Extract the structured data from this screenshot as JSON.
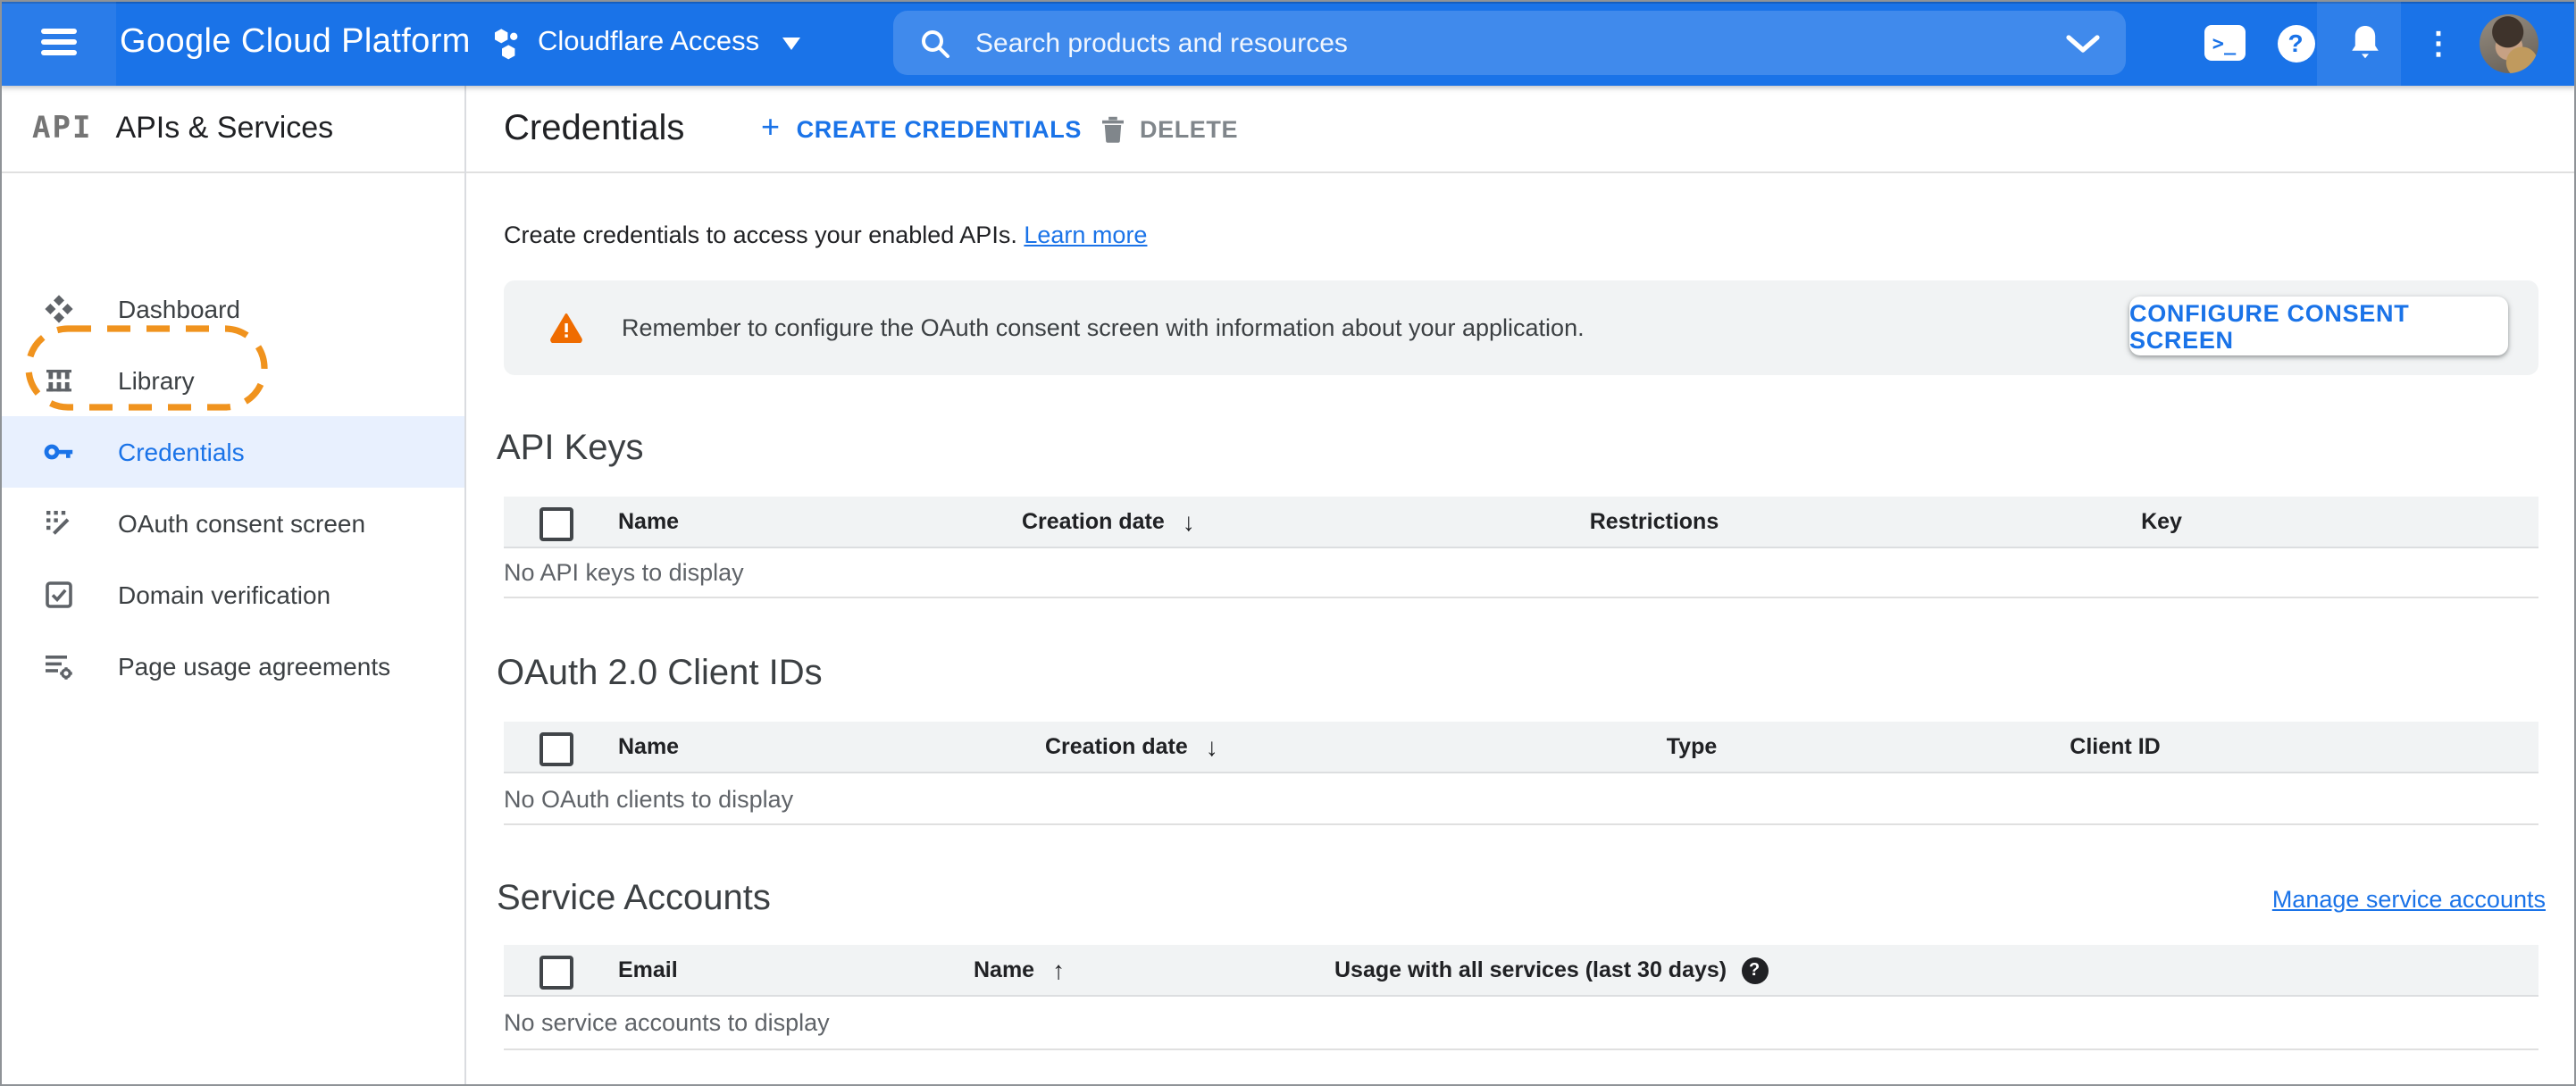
{
  "header": {
    "logo": "Google Cloud Platform",
    "project": {
      "name": "Cloudflare Access"
    },
    "search": {
      "placeholder": "Search products and resources"
    }
  },
  "sidebar": {
    "product_initials": "API",
    "title": "APIs & Services",
    "items": [
      {
        "label": "Dashboard"
      },
      {
        "label": "Library"
      },
      {
        "label": "Credentials"
      },
      {
        "label": "OAuth consent screen"
      },
      {
        "label": "Domain verification"
      },
      {
        "label": "Page usage agreements"
      }
    ],
    "active_item": "Credentials"
  },
  "toolbar": {
    "title": "Credentials",
    "create_label": "CREATE CREDENTIALS",
    "delete_label": "DELETE"
  },
  "intro": {
    "text": "Create credentials to access your enabled APIs.",
    "link": "Learn more"
  },
  "banner": {
    "message": "Remember to configure the OAuth consent screen with information about your application.",
    "action": "CONFIGURE CONSENT SCREEN"
  },
  "sections": {
    "api_keys": {
      "title": "API Keys",
      "columns": [
        "Name",
        "Creation date",
        "Restrictions",
        "Key"
      ],
      "sorted_by": "Creation date",
      "sort_direction": "desc",
      "empty": "No API keys to display"
    },
    "oauth_clients": {
      "title": "OAuth 2.0 Client IDs",
      "columns": [
        "Name",
        "Creation date",
        "Type",
        "Client ID"
      ],
      "sorted_by": "Creation date",
      "sort_direction": "desc",
      "empty": "No OAuth clients to display"
    },
    "service_accounts": {
      "title": "Service Accounts",
      "link": "Manage service accounts",
      "columns": [
        "Email",
        "Name",
        "Usage with all services (last 30 days)"
      ],
      "sorted_by": "Name",
      "sort_direction": "asc",
      "empty": "No service accounts to display"
    }
  },
  "icons": {
    "sort_desc": "↓",
    "sort_asc": "↑",
    "plus": "+",
    "more_options": "⋮",
    "shell_prompt": ">_",
    "help": "?",
    "usage_help": "?"
  },
  "colors": {
    "accent_blue": "#1a73e8",
    "active_item_bg": "#e8f0fe",
    "tutorial_orange": "#f0931e",
    "warning_orange": "#ef6c00",
    "banner_bg": "#f1f3f4"
  }
}
